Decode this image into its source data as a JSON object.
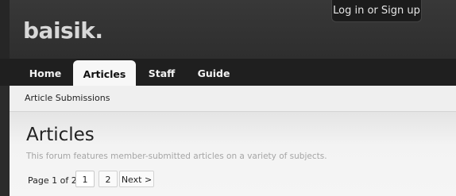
{
  "header": {
    "logo": "baisik.",
    "login_label": "Log in or Sign up"
  },
  "nav": {
    "tabs": [
      {
        "label": "Home",
        "active": false
      },
      {
        "label": "Articles",
        "active": true
      },
      {
        "label": "Staff",
        "active": false
      },
      {
        "label": "Guide",
        "active": false
      }
    ],
    "subnav_item": "Article Submissions"
  },
  "main": {
    "title": "Articles",
    "description": "This forum features member-submitted articles on a variety of subjects.",
    "pager": {
      "label": "Page 1 of 2",
      "pages": [
        "1",
        "2"
      ],
      "current_page": "1",
      "next_label": "Next >"
    }
  },
  "colors": {
    "header_bg": "#333333",
    "nav_bg": "#1f1f1f",
    "active_tab_bg": "#f7f7f7",
    "content_bg": "#f3f3f3"
  }
}
